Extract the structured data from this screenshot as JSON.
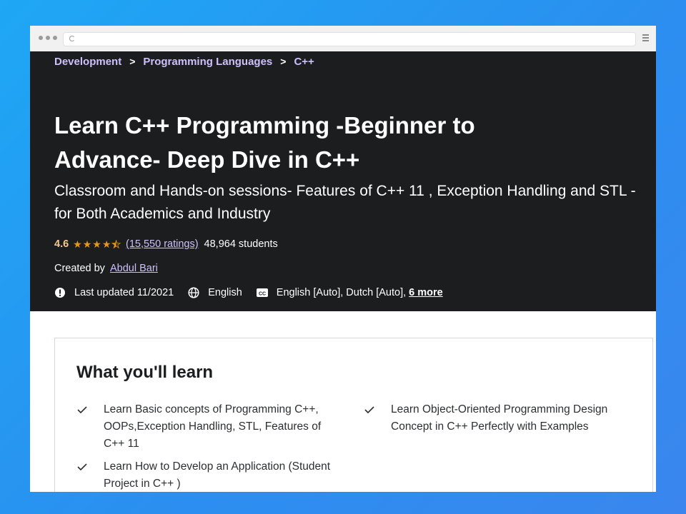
{
  "breadcrumb": {
    "items": [
      "Development",
      "Programming Languages",
      "C++"
    ],
    "separator": ">"
  },
  "course": {
    "title_line1": "Learn C++ Programming -Beginner to",
    "title_line2": "Advance- Deep Dive in C++",
    "subtitle": "Classroom and Hands-on sessions- Features of C++ 11 , Exception Handling and STL - for Both Academics and Industry",
    "rating": "4.6",
    "rating_stars": 4.5,
    "ratings_count": "(15,550 ratings)",
    "students": "48,964 students",
    "created_by_label": "Created by",
    "author": "Abdul Bari",
    "last_updated": "Last updated 11/2021",
    "language": "English",
    "captions": "English [Auto], Dutch [Auto],",
    "captions_more": "6 more"
  },
  "learn": {
    "heading": "What you'll learn",
    "items": [
      "Learn Basic concepts of Programming C++, OOPs,Exception Handling, STL, Features of C++ 11",
      "Learn Object-Oriented Programming Design Concept in C++ Perfectly with Examples",
      "Learn How to Develop an Application (Student Project in C++ )"
    ]
  },
  "colors": {
    "hero_bg": "#1c1d1f",
    "link_purple": "#cec0fc",
    "rating_gold": "#f3ca8c",
    "star_orange": "#e59819",
    "backdrop_blue": "#2b8ff0"
  },
  "icons": [
    "reload-icon",
    "menu-icon",
    "star-icon",
    "alert-icon",
    "globe-icon",
    "closed-captions-icon",
    "check-icon"
  ]
}
